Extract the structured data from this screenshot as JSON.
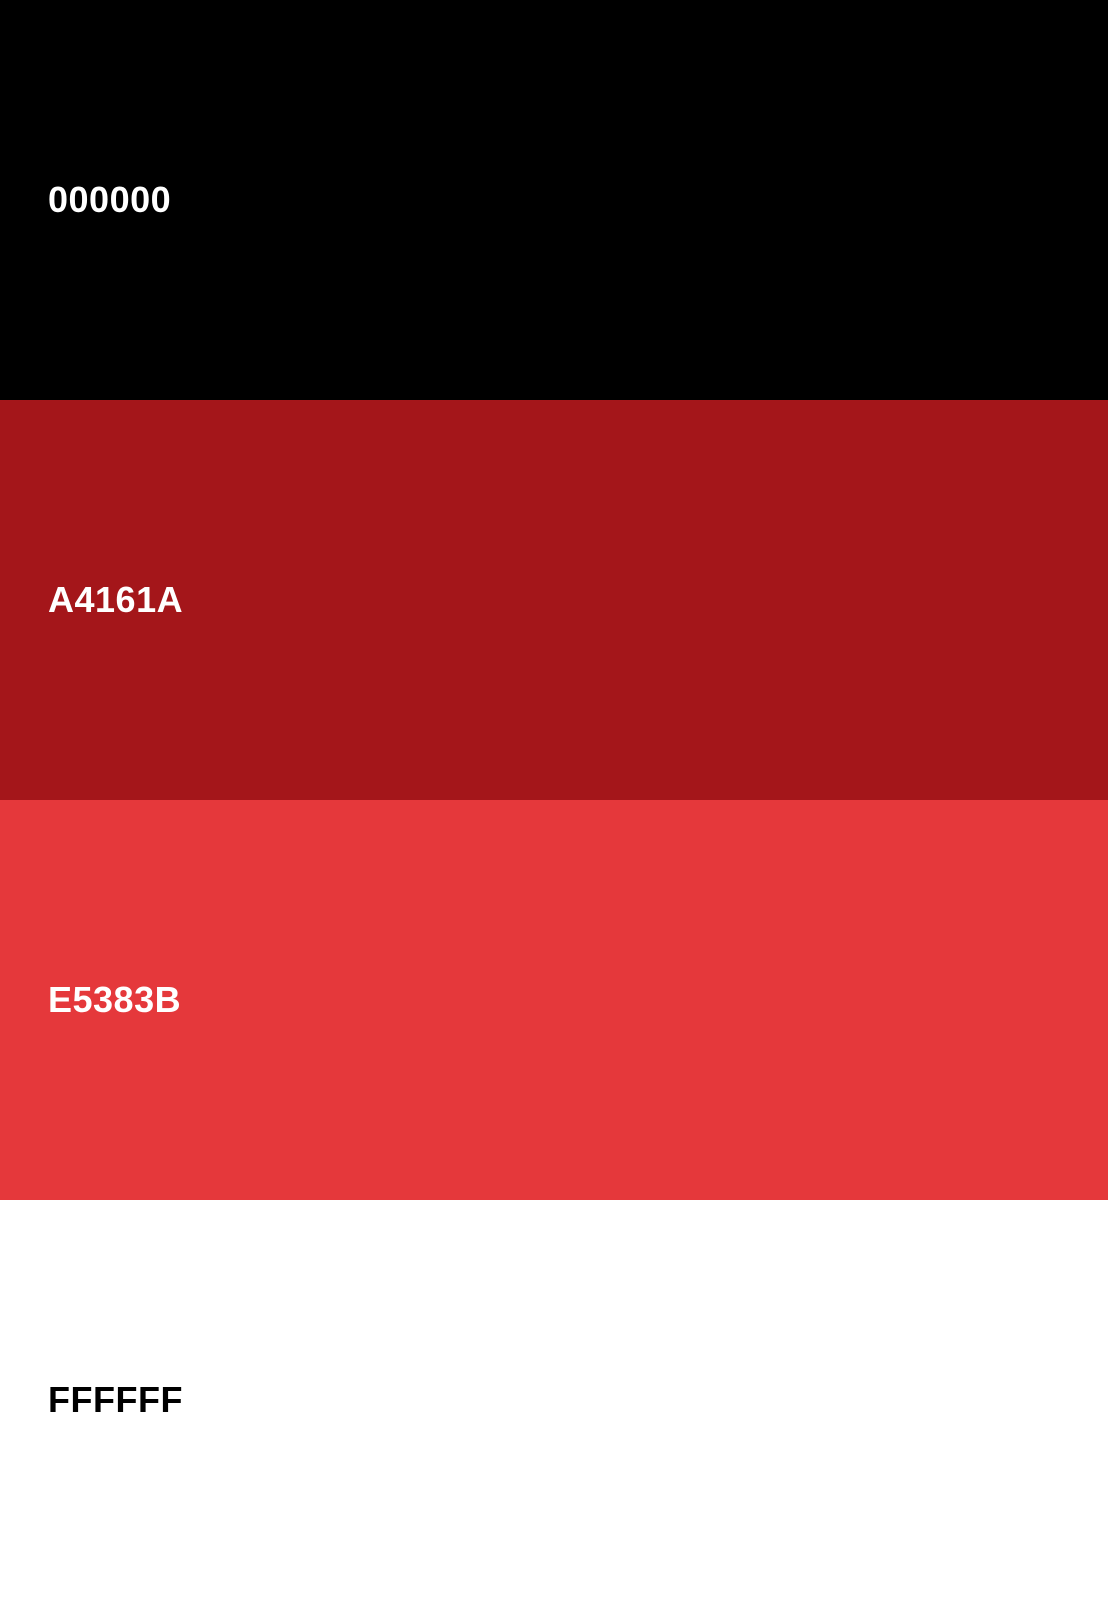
{
  "palette": {
    "swatches": [
      {
        "label": "000000",
        "color": "#000000",
        "text_color": "#FFFFFF"
      },
      {
        "label": "A4161A",
        "color": "#A4161A",
        "text_color": "#FFFFFF"
      },
      {
        "label": "E5383B",
        "color": "#E5383B",
        "text_color": "#FFFFFF"
      },
      {
        "label": "FFFFFF",
        "color": "#FFFFFF",
        "text_color": "#000000"
      }
    ]
  }
}
